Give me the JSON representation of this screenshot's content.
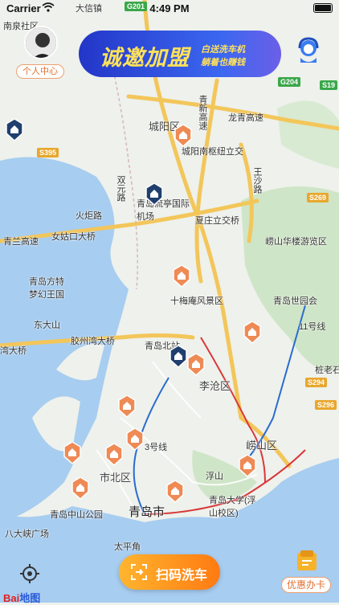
{
  "status_bar": {
    "carrier": "Carrier",
    "time": "4:49 PM"
  },
  "profile": {
    "label": "个人中心"
  },
  "banner": {
    "main_text": "诚邀加盟",
    "sub_line1": "白送洗车机",
    "sub_line2": "躺着也赚钱"
  },
  "scan_button": {
    "label": "扫码洗车"
  },
  "coupon": {
    "label": "优惠办卡"
  },
  "baidu_logo": {
    "bai": "Bai",
    "du": "地图"
  },
  "map": {
    "labels": {
      "nanguan": "南泉社区",
      "datong": "大信镇",
      "chengyang": "城阳区",
      "chengyang_interchange": "城阳南枢纽立交",
      "qingxin": "青新高速",
      "longqing": "龙青高速",
      "shuangyuan": "双元路",
      "airport": "青岛流亭国际机场",
      "huoju": "火炬路",
      "xiazhuang": "夏庄立交桥",
      "qinglan": "青兰高速",
      "nvgukou": "女姑口大桥",
      "wangsha": "王沙路",
      "laoshan_scenic": "崂山华楼游览区",
      "fangte": "青岛方特梦幻王国",
      "dongda": "东大山",
      "shimei": "十梅庵风景区",
      "qingdao_shiyuan": "青岛世园会",
      "jiaozhouwan_bridge": "胶州湾大桥",
      "jiaozhouwan_tunnel": "湾大桥",
      "north_station": "青岛北站",
      "licang": "李沧区",
      "zhanggeng": "桩老石",
      "laoshan": "崂山区",
      "shibei": "市北区",
      "fushan": "浮山",
      "zhongshan_park": "青岛中山公园",
      "qingdao_city": "青岛市",
      "qingdao_univ": "青岛大学(浮山校区)",
      "badaxia": "八大峡广场",
      "taiping": "太平角",
      "line3": "3号线",
      "line11": "11号线"
    },
    "shields": [
      "G201",
      "G204",
      "S19",
      "S395",
      "S269",
      "S294",
      "S296"
    ],
    "colors": {
      "water": "#a7cdf0",
      "land": "#eef1ec",
      "green": "#cfe5c7",
      "highway": "#f3c65a",
      "pin": "#ef8a55",
      "shield": "#3aa74a"
    }
  }
}
